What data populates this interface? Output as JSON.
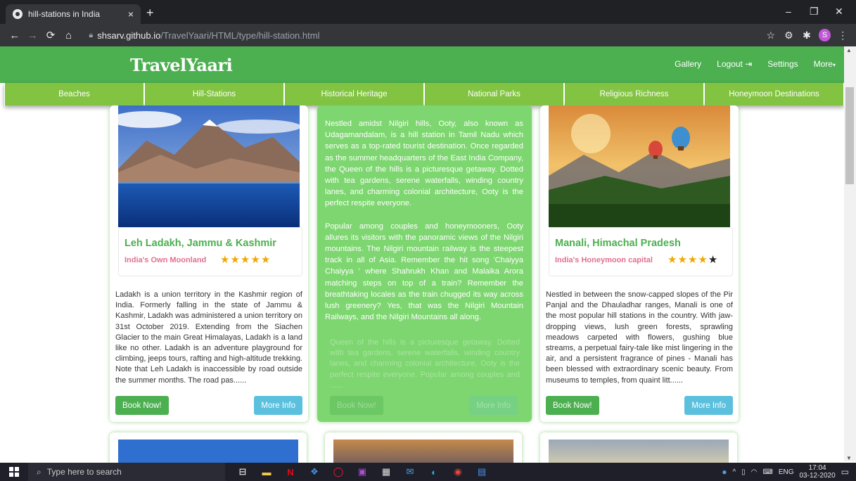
{
  "browser": {
    "tab_title": "hill-stations in India",
    "tab_close": "×",
    "new_tab": "+",
    "url_host": "shsarv.github.io",
    "url_path": "/TravelYaari/HTML/type/hill-station.html",
    "profile_initial": "S",
    "window_controls": [
      "–",
      "❐",
      "✕"
    ]
  },
  "site": {
    "brand": "TravelYaari",
    "nav": [
      "Gallery",
      "Logout",
      "Settings",
      "More"
    ],
    "categories": [
      "Beaches",
      "Hill-Stations",
      "Historical Heritage",
      "National Parks",
      "Religious Richness",
      "Honeymoon Destinations"
    ]
  },
  "cards": [
    {
      "title": "Leh Ladakh, Jammu & Kashmir",
      "tagline": "India's Own Moonland",
      "rating": 5,
      "description": "Ladakh is a union territory in the Kashmir region of India. Formerly falling in the state of Jammu & Kashmir, Ladakh was administered a union territory on 31st October 2019. Extending from the Siachen Glacier to the main Great Himalayas, Ladakh is a land like no other. Ladakh is an adventure playground for climbing, jeeps tours, rafting and high-altitude trekking. Note that Leh Ladakh is inaccessible by road outside the summer months. The road pas......",
      "book_label": "Book Now!",
      "more_label": "More Info"
    },
    {
      "paragraph1": "Nestled amidst Nilgiri hills, Ooty, also known as Udagamandalam, is a hill station in Tamil Nadu which serves as a top-rated tourist destination. Once regarded as the summer headquarters of the East India Company, the Queen of the hills is a picturesque getaway. Dotted with tea gardens, serene waterfalls, winding country lanes, and charming colonial architecture, Ooty is the perfect respite everyone.",
      "paragraph2": "Popular among couples and honeymooners, Ooty allures its visitors with the panoramic views of the Nilgiri mountains. The Nilgiri mountain railway is the steepest track in all of Asia. Remember the hit song 'Chaiyya Chaiyya ' where Shahrukh Khan and Malaika Arora matching steps on top of a train? Remember the breathtaking locales as the train chugged its way across lush greenery? Yes, that was the Nilgiri Mountain Railways, and the Nilgiri Mountains all along.",
      "ghost_text": "Queen of the hills is a picturesque getaway. Dotted with tea gardens, serene waterfalls, winding country lanes, and charming colonial architecture, Ooty is the perfect respite everyone. Popular among couples and ......",
      "book_label": "Book Now!",
      "more_label": "More Info"
    },
    {
      "title": "Manali, Himachal Pradesh",
      "tagline": "India's Honeymoon capital",
      "rating": 4,
      "description": "Nestled in between the snow-capped slopes of the Pir Panjal and the Dhauladhar ranges, Manali is one of the most popular hill stations in the country. With jaw-dropping views, lush green forests, sprawling meadows carpeted with flowers, gushing blue streams, a perpetual fairy-tale like mist lingering in the air, and a persistent fragrance of pines - Manali has been blessed with extraordinary scenic beauty. From museums to temples, from quaint litt......",
      "book_label": "Book Now!",
      "more_label": "More Info"
    }
  ],
  "taskbar": {
    "search_placeholder": "Type here to search",
    "lang": "ENG",
    "time": "17:04",
    "date": "03-12-2020"
  },
  "colors": {
    "brand_green": "#4caf50",
    "category_green": "#82c341",
    "hover_green": "#7dd66f",
    "tagline_pink": "#e36f8f",
    "info_blue": "#5bc0de"
  }
}
